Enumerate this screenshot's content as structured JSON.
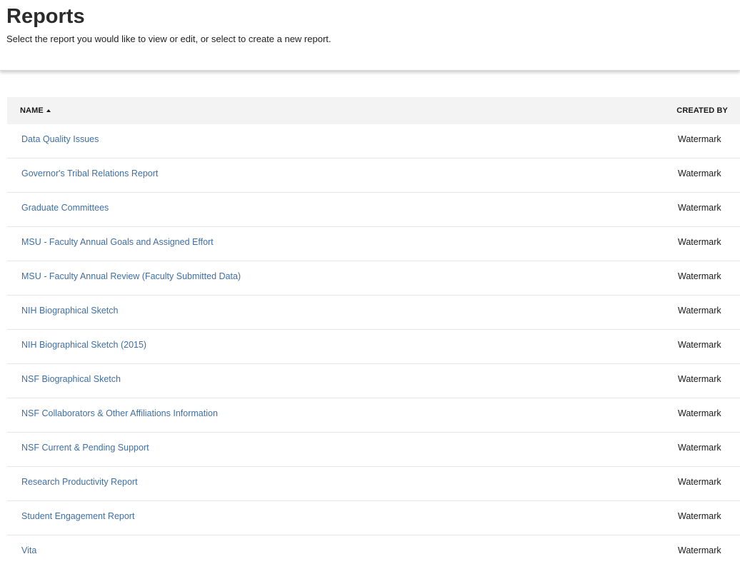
{
  "header": {
    "title": "Reports",
    "subtitle": "Select the report you would like to view or edit, or select to create a new report."
  },
  "table": {
    "columns": {
      "name": "NAME",
      "created_by": "CREATED BY"
    },
    "sort": {
      "column": "name",
      "direction": "ascending",
      "icon": "sort-ascending-icon"
    },
    "rows": [
      {
        "name": "Data Quality Issues",
        "created_by": "Watermark"
      },
      {
        "name": "Governor's Tribal Relations Report",
        "created_by": "Watermark"
      },
      {
        "name": "Graduate Committees",
        "created_by": "Watermark"
      },
      {
        "name": "MSU - Faculty Annual Goals and Assigned Effort",
        "created_by": "Watermark"
      },
      {
        "name": "MSU - Faculty Annual Review (Faculty Submitted Data)",
        "created_by": "Watermark"
      },
      {
        "name": "NIH Biographical Sketch",
        "created_by": "Watermark"
      },
      {
        "name": "NIH Biographical Sketch (2015)",
        "created_by": "Watermark"
      },
      {
        "name": "NSF Biographical Sketch",
        "created_by": "Watermark"
      },
      {
        "name": "NSF Collaborators & Other Affiliations Information",
        "created_by": "Watermark"
      },
      {
        "name": "NSF Current & Pending Support",
        "created_by": "Watermark"
      },
      {
        "name": "Research Productivity Report",
        "created_by": "Watermark"
      },
      {
        "name": "Student Engagement Report",
        "created_by": "Watermark"
      },
      {
        "name": "Vita",
        "created_by": "Watermark"
      }
    ]
  },
  "colors": {
    "link": "#3f6fa6",
    "header_bg": "#f3f3f4",
    "row_divider": "#e6e6e6"
  }
}
